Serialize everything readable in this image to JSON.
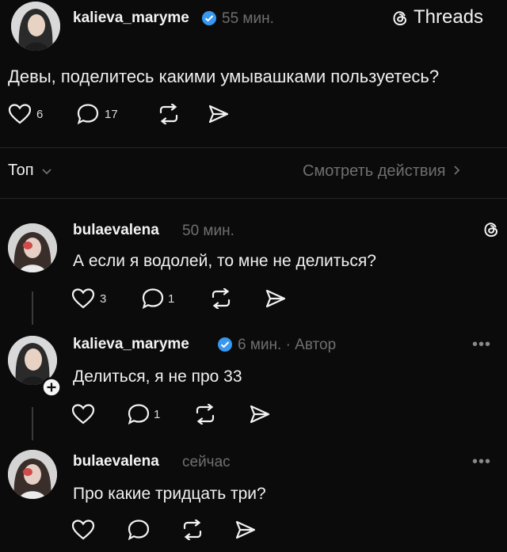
{
  "post": {
    "author": "kalieva_maryme",
    "time": "55 мин.",
    "platform": "Threads",
    "text": "Девы, поделитесь какими умывашками пользуетесь?",
    "likes": "6",
    "replies": "17"
  },
  "filter": {
    "sort_label": "Топ",
    "activity_link": "Смотреть действия"
  },
  "comments": [
    {
      "author": "bulaevalena",
      "time": "50 мин.",
      "text": "А если я водолей, то мне не делиться?",
      "likes": "3",
      "replies": "1"
    },
    {
      "author": "kalieva_maryme",
      "time": "6 мин. · Автор",
      "text": "Делиться, я не про 33",
      "likes": "",
      "replies": "1"
    },
    {
      "author": "bulaevalena",
      "time": "сейчас",
      "text": "Про какие тридцать три?",
      "likes": "",
      "replies": ""
    }
  ],
  "icons": {
    "verified": "verified-badge-icon",
    "threads": "threads-logo-icon",
    "like": "heart-icon",
    "reply": "comment-icon",
    "repost": "repost-icon",
    "share": "send-icon",
    "more": "more-icon",
    "follow": "plus-icon"
  },
  "colors": {
    "background": "#0b0b0b",
    "verified": "#3897f0",
    "muted": "#6f6f6f"
  }
}
